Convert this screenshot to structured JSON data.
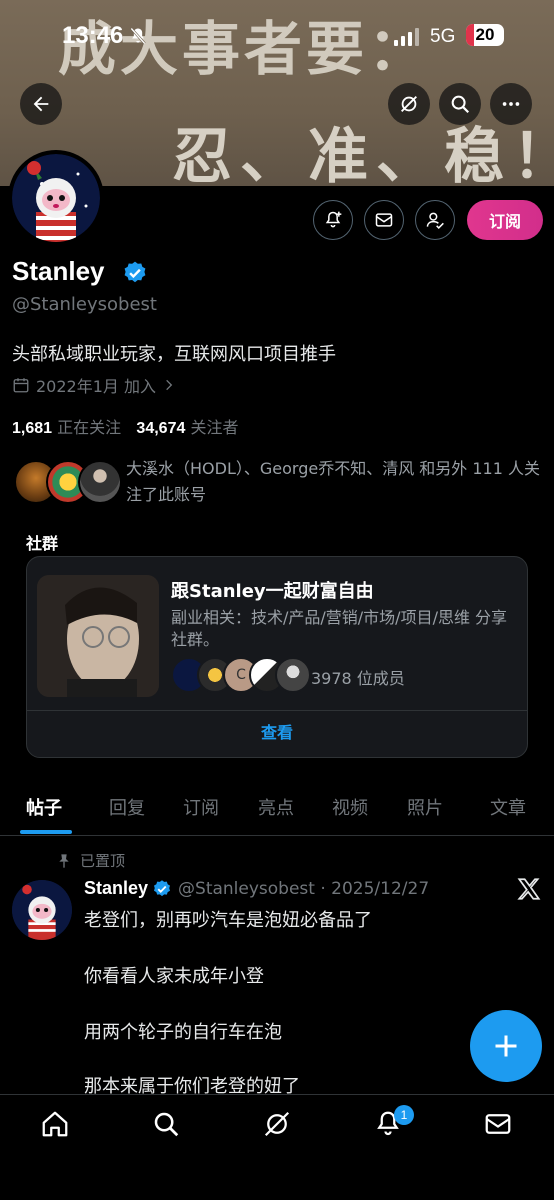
{
  "status_bar": {
    "time": "13:46",
    "network": "5G",
    "battery": "20",
    "battery_level": 0.2
  },
  "banner": {
    "line1": "成大事者要：",
    "line2": "忍、准、稳！"
  },
  "profile": {
    "name": "Stanley",
    "handle": "@Stanleysobest",
    "bio": "头部私域职业玩家，互联网风口项目推手",
    "joined": "2022年1月 加入",
    "following_count": "1,681",
    "following_label": "正在关注",
    "followers_count": "34,674",
    "followers_label": "关注者",
    "known_followers": "大溪水（HODL）、George乔不知、清风 和另外 111 人关注了此账号",
    "subscribe_label": "订阅"
  },
  "community_section": {
    "title": "社群",
    "name": "跟Stanley一起财富自由",
    "description": "副业相关：技术/产品/营销/市场/项目/思维 分享社群。",
    "member_count": "3978 位成员",
    "view_label": "查看",
    "member_initial": "C"
  },
  "tabs": [
    "帖子",
    "回复",
    "订阅",
    "亮点",
    "视频",
    "照片",
    "文章"
  ],
  "post": {
    "pinned_label": "已置顶",
    "author": "Stanley",
    "meta": "@Stanleysobest · 2025/12/27",
    "lines": [
      "老登们，别再吵汽车是泡妞必备品了",
      "你看看人家未成年小登",
      "用两个轮子的自行车在泡",
      "那本来属于你们老登的妞了"
    ]
  },
  "bottom_nav": {
    "notification_badge": "1"
  },
  "colors": {
    "accent": "#1d9bf0",
    "subscribe": "#d22e8b",
    "background": "#000000"
  }
}
